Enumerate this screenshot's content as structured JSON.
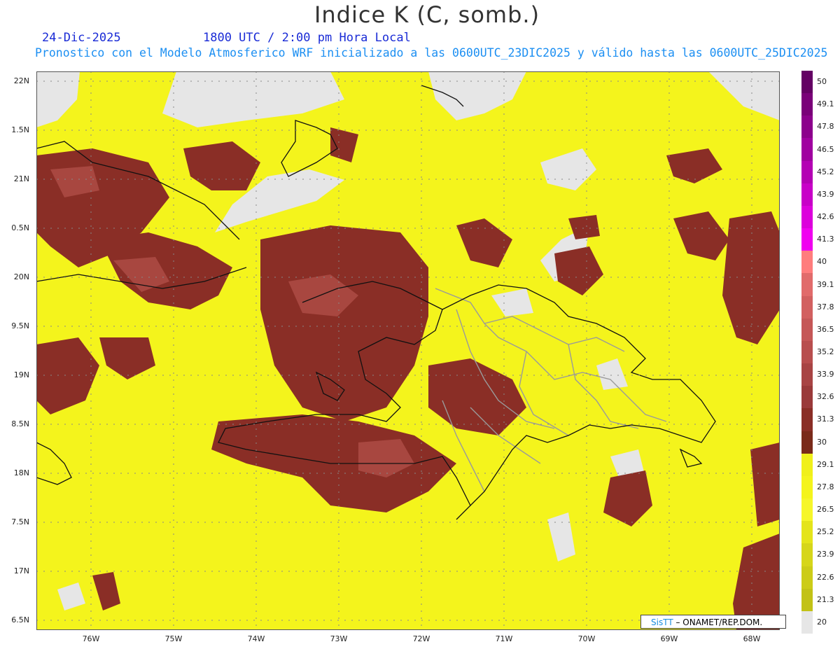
{
  "header": {
    "title": "Indice K (C, somb.)",
    "date": "24-Dic-2025",
    "time": "1800 UTC / 2:00 pm Hora Local",
    "info": "Pronostico con el Modelo Atmosferico WRF inicializado a las 0600UTC_23DIC2025 y válido hasta las  0600UTC_25DIC2025"
  },
  "axes": {
    "lat_labels": [
      "22N",
      "1.5N",
      "21N",
      "0.5N",
      "20N",
      "9.5N",
      "19N",
      "8.5N",
      "18N",
      "7.5N",
      "17N",
      "6.5N"
    ],
    "lon_labels": [
      "76W",
      "75W",
      "74W",
      "73W",
      "72W",
      "71W",
      "70W",
      "69W",
      "68W"
    ]
  },
  "colorbar": {
    "labels": [
      "50",
      "49.1",
      "47.8",
      "46.5",
      "45.2",
      "43.9",
      "42.6",
      "41.3",
      "40",
      "39.1",
      "37.8",
      "36.5",
      "35.2",
      "33.9",
      "32.6",
      "31.3",
      "30",
      "29.1",
      "27.8",
      "26.5",
      "25.2",
      "23.9",
      "22.6",
      "21.3",
      "20"
    ],
    "colors": [
      "#640064",
      "#7a0079",
      "#8c008c",
      "#a000a0",
      "#b400b4",
      "#c800c8",
      "#dc00dc",
      "#f000f0",
      "#ff7d7d",
      "#e16b6b",
      "#d26060",
      "#c55757",
      "#b84e4e",
      "#a84444",
      "#9a3a3a",
      "#8a2e26",
      "#7a2a1a",
      "#f0f01a",
      "#f4f41c",
      "#f6f62a",
      "#e4e41a",
      "#d6d61a",
      "#cccc18",
      "#c2c216",
      "#e6e6e6"
    ]
  },
  "credit": {
    "brand": "SisTT",
    "text": " – ONAMET/REP.DOM."
  },
  "map_colors": {
    "low": "#e6e6e6",
    "mid": "#f4f41c",
    "high": "#8a2e26",
    "high_light": "#b5524c",
    "coast": "#111111",
    "borders": "#9a9a9a"
  }
}
